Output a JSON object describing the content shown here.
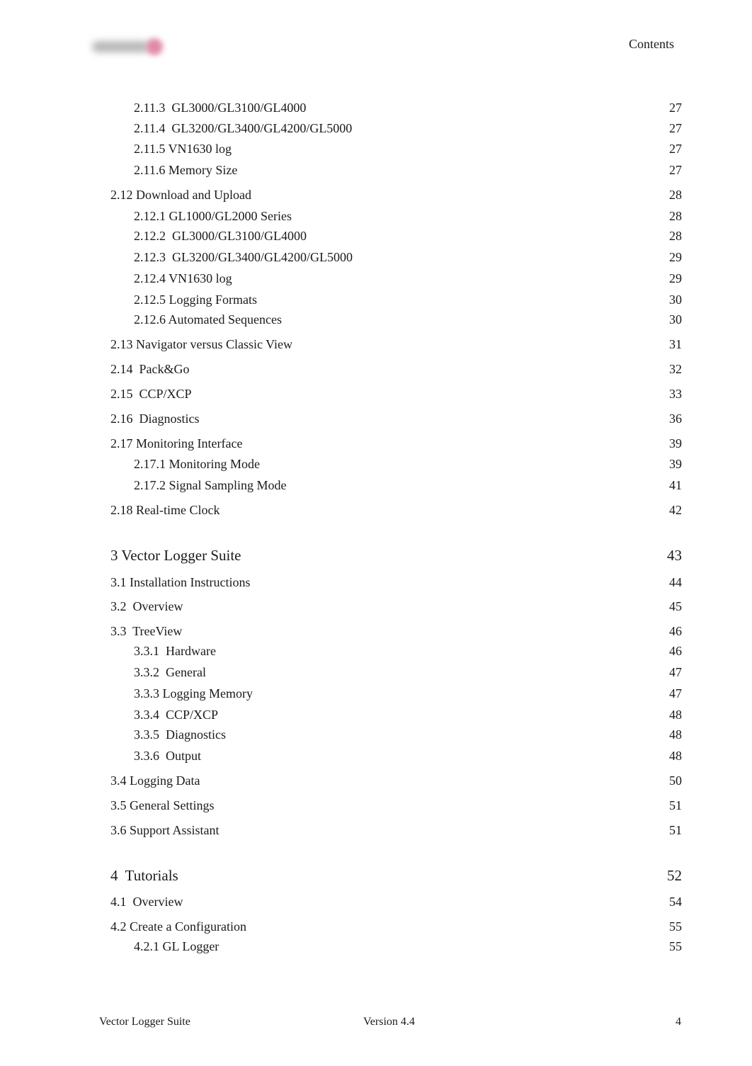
{
  "header": {
    "logo": "vector-logo",
    "title": "Contents"
  },
  "toc": [
    {
      "level": 2,
      "label": "2.11.3  GL3000/GL3100/GL4000",
      "page": "27"
    },
    {
      "level": 2,
      "label": "2.11.4  GL3200/GL3400/GL4200/GL5000",
      "page": "27"
    },
    {
      "level": 2,
      "label": "2.11.5 VN1630 log",
      "page": "27"
    },
    {
      "level": 2,
      "label": "2.11.6 Memory Size",
      "page": "27"
    },
    {
      "level": 1,
      "label": "2.12 Download and Upload",
      "page": "28"
    },
    {
      "level": 2,
      "label": "2.12.1 GL1000/GL2000 Series",
      "page": "28"
    },
    {
      "level": 2,
      "label": "2.12.2  GL3000/GL3100/GL4000",
      "page": "28"
    },
    {
      "level": 2,
      "label": "2.12.3  GL3200/GL3400/GL4200/GL5000",
      "page": "29"
    },
    {
      "level": 2,
      "label": "2.12.4 VN1630 log",
      "page": "29"
    },
    {
      "level": 2,
      "label": "2.12.5 Logging Formats",
      "page": "30"
    },
    {
      "level": 2,
      "label": "2.12.6 Automated Sequences",
      "page": "30"
    },
    {
      "level": 1,
      "label": "2.13 Navigator versus Classic View",
      "page": "31"
    },
    {
      "level": 1,
      "label": "2.14  Pack&Go",
      "page": "32"
    },
    {
      "level": 1,
      "label": "2.15  CCP/XCP",
      "page": "33"
    },
    {
      "level": 1,
      "label": "2.16  Diagnostics",
      "page": "36"
    },
    {
      "level": 1,
      "label": "2.17 Monitoring Interface",
      "page": "39"
    },
    {
      "level": 2,
      "label": "2.17.1 Monitoring Mode",
      "page": "39"
    },
    {
      "level": 2,
      "label": "2.17.2 Signal Sampling Mode",
      "page": "41"
    },
    {
      "level": 1,
      "label": "2.18 Real-time Clock",
      "page": "42"
    },
    {
      "level": 0,
      "label": "3 Vector Logger Suite",
      "page": "43"
    },
    {
      "level": 1,
      "label": "3.1 Installation Instructions",
      "page": "44"
    },
    {
      "level": 1,
      "label": "3.2  Overview",
      "page": "45"
    },
    {
      "level": 1,
      "label": "3.3  TreeView",
      "page": "46"
    },
    {
      "level": 2,
      "label": "3.3.1  Hardware",
      "page": "46"
    },
    {
      "level": 2,
      "label": "3.3.2  General",
      "page": "47"
    },
    {
      "level": 2,
      "label": "3.3.3 Logging Memory",
      "page": "47"
    },
    {
      "level": 2,
      "label": "3.3.4  CCP/XCP",
      "page": "48"
    },
    {
      "level": 2,
      "label": "3.3.5  Diagnostics",
      "page": "48"
    },
    {
      "level": 2,
      "label": "3.3.6  Output",
      "page": "48"
    },
    {
      "level": 1,
      "label": "3.4 Logging Data",
      "page": "50"
    },
    {
      "level": 1,
      "label": "3.5 General Settings",
      "page": "51"
    },
    {
      "level": 1,
      "label": "3.6 Support Assistant",
      "page": "51"
    },
    {
      "level": 0,
      "label": "4  Tutorials",
      "page": "52"
    },
    {
      "level": 1,
      "label": "4.1  Overview",
      "page": "54"
    },
    {
      "level": 1,
      "label": "4.2 Create a Configuration",
      "page": "55"
    },
    {
      "level": 2,
      "label": "4.2.1 GL Logger",
      "page": "55"
    }
  ],
  "footer": {
    "left": "Vector Logger Suite",
    "center": "Version 4.4",
    "right": "4"
  }
}
